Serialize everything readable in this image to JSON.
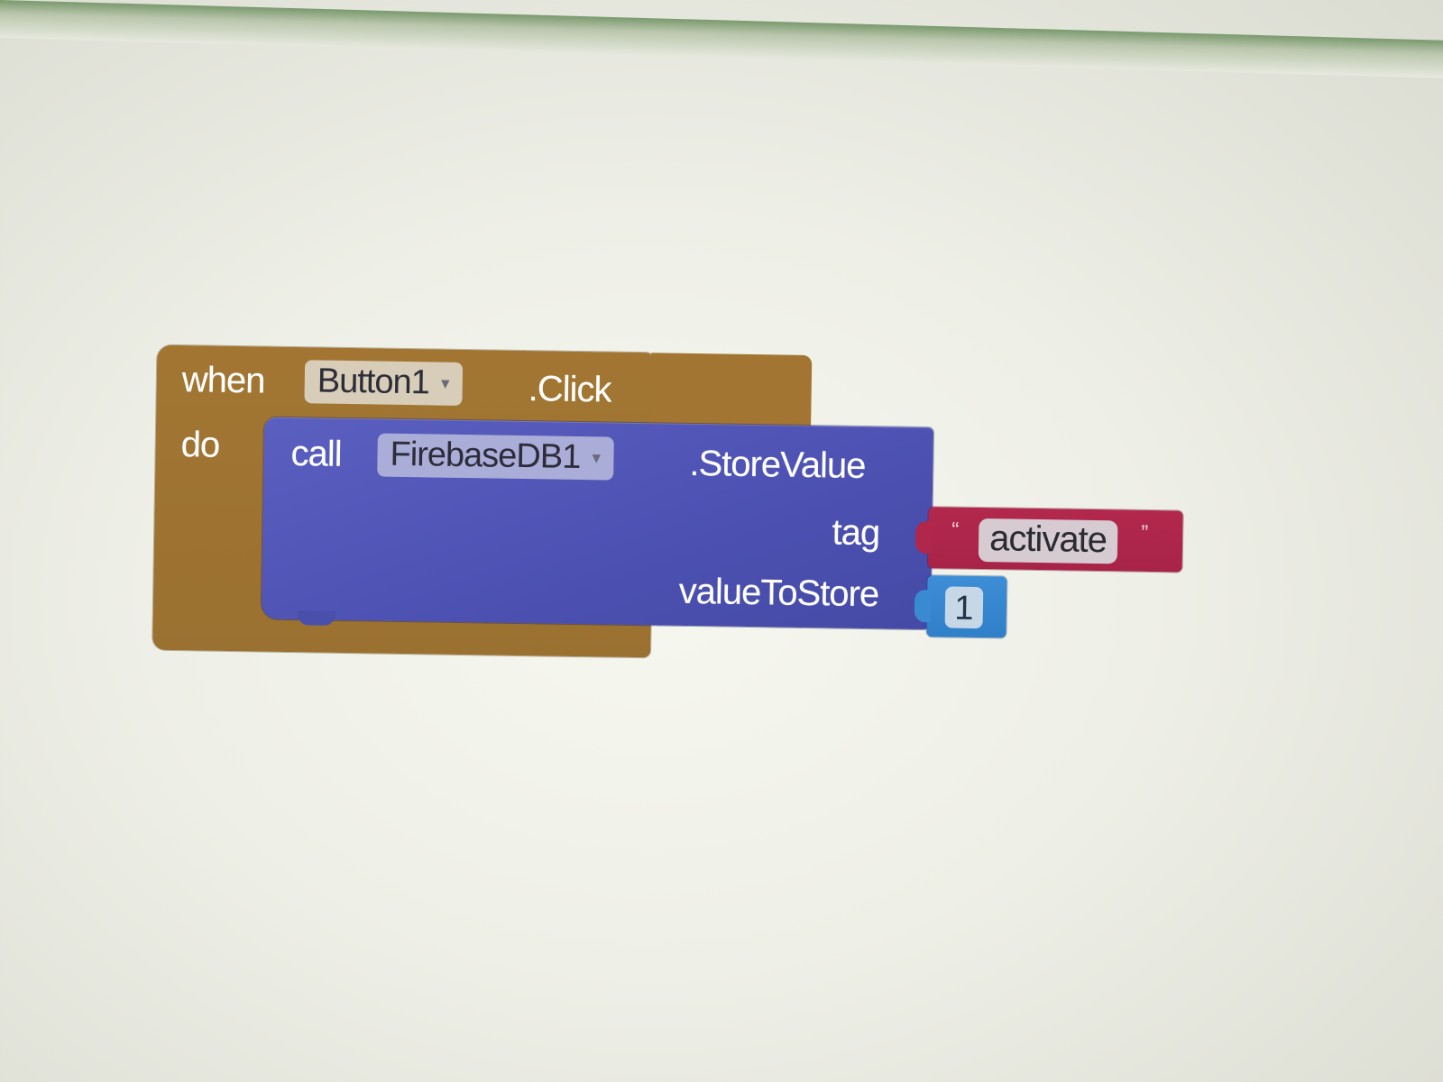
{
  "event_block": {
    "keyword_when": "when",
    "component": "Button1",
    "event": ".Click",
    "keyword_do": "do"
  },
  "call_block": {
    "keyword_call": "call",
    "component": "FirebaseDB1",
    "method": ".StoreValue",
    "arg_tag_label": "tag",
    "arg_value_label": "valueToStore"
  },
  "text_block": {
    "open_quote": "“",
    "value": "activate",
    "close_quote": "”"
  },
  "number_block": {
    "value": "1"
  },
  "colors": {
    "event_block": "#a27632",
    "call_block": "#4d52b3",
    "text_block": "#b3284d",
    "number_block": "#3d8ed6"
  },
  "icons": {
    "dropdown": "chevron-down-icon"
  }
}
